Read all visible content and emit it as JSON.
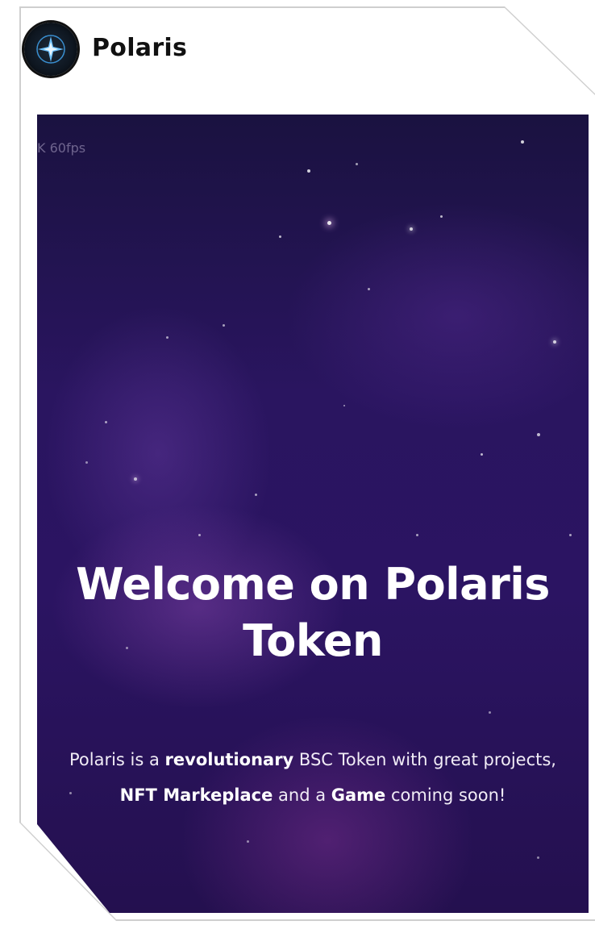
{
  "header": {
    "brand_name": "Polaris",
    "logo_icon": "compass-star-icon"
  },
  "hero": {
    "fps_counter": "K 60fps",
    "title_line1": "Welcome on Polaris",
    "title_line2": "Token",
    "description": {
      "p1": "Polaris is a ",
      "b1": "revolutionary",
      "p2": " BSC Token with great projects, ",
      "b2": "NFT Markeplace",
      "p3": " and a ",
      "b3": "Game",
      "p4": " coming soon!"
    }
  },
  "colors": {
    "hero_background": "#2a1560",
    "title_text": "#ffffff",
    "brand_text": "#111111"
  }
}
